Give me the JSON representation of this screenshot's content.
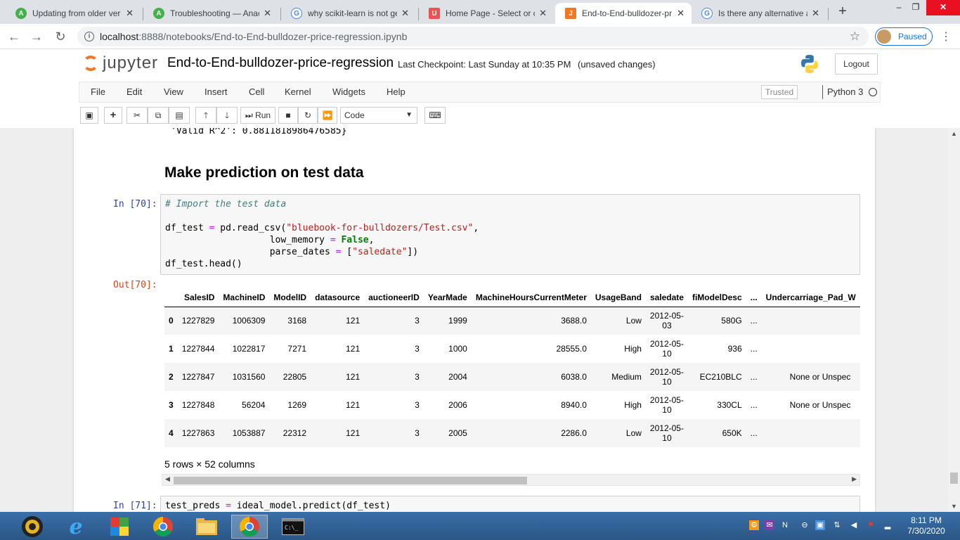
{
  "browser": {
    "tabs": [
      {
        "label": "Updating from older ver",
        "favicon": "anaconda-icon",
        "color": "#43b049"
      },
      {
        "label": "Troubleshooting — Anac",
        "favicon": "anaconda-icon",
        "color": "#43b049"
      },
      {
        "label": "why scikit-learn is not ge",
        "favicon": "google-icon",
        "color": "#4285f4"
      },
      {
        "label": "Home Page - Select or c",
        "favicon": "udemy-icon",
        "color": "#ec5252"
      },
      {
        "label": "End-to-End-bulldozer-pr",
        "favicon": "jupyter-icon",
        "color": "#f37726"
      },
      {
        "label": "Is there any alternative a",
        "favicon": "google-icon",
        "color": "#4285f4"
      }
    ],
    "url": "localhost:8888/notebooks/End-to-End-bulldozer-price-regression.ipynb",
    "url_host": "localhost",
    "url_rest": ":8888/notebooks/End-to-End-bulldozer-price-regression.ipynb",
    "profile_label": "Paused"
  },
  "jupyter": {
    "logo_text": "jupyter",
    "notebook_title": "End-to-End-bulldozer-price-regression",
    "checkpoint": "Last Checkpoint: Last Sunday at 10:35 PM",
    "unsaved": "(unsaved changes)",
    "logout_label": "Logout",
    "menu": [
      "File",
      "Edit",
      "View",
      "Insert",
      "Cell",
      "Kernel",
      "Widgets",
      "Help"
    ],
    "trusted_label": "Trusted",
    "kernel_name": "Python 3",
    "run_label": "Run",
    "cell_type": "Code"
  },
  "notebook": {
    "prev_output": "'Valid R^2': 0.8811818986476585}",
    "heading": "Make prediction on test data",
    "cell70": {
      "in_prompt": "In [70]:",
      "out_prompt": "Out[70]:",
      "comment": "# Import the test data",
      "line2_a": "df_test ",
      "line2_eq": "=",
      "line2_b": " pd.read_csv(",
      "line2_str": "\"bluebook-for-bulldozers/Test.csv\"",
      "line2_c": ",",
      "line3_a": "                   low_memory ",
      "line3_eq": "=",
      "line3_kw": " False",
      "line3_c": ",",
      "line4_a": "                   parse_dates ",
      "line4_eq": "=",
      "line4_b": " [",
      "line4_str": "\"saledate\"",
      "line4_c": "])",
      "line5": "df_test.head()"
    },
    "table": {
      "columns": [
        "",
        "SalesID",
        "MachineID",
        "ModelID",
        "datasource",
        "auctioneerID",
        "YearMade",
        "MachineHoursCurrentMeter",
        "UsageBand",
        "saledate",
        "fiModelDesc",
        "...",
        "Undercarriage_Pad_W"
      ],
      "rows": [
        [
          "0",
          "1227829",
          "1006309",
          "3168",
          "121",
          "3",
          "1999",
          "3688.0",
          "Low",
          "2012-05-03",
          "580G",
          "...",
          ""
        ],
        [
          "1",
          "1227844",
          "1022817",
          "7271",
          "121",
          "3",
          "1000",
          "28555.0",
          "High",
          "2012-05-10",
          "936",
          "...",
          ""
        ],
        [
          "2",
          "1227847",
          "1031560",
          "22805",
          "121",
          "3",
          "2004",
          "6038.0",
          "Medium",
          "2012-05-10",
          "EC210BLC",
          "...",
          "None or Unspec"
        ],
        [
          "3",
          "1227848",
          "56204",
          "1269",
          "121",
          "3",
          "2006",
          "8940.0",
          "High",
          "2012-05-10",
          "330CL",
          "...",
          "None or Unspec"
        ],
        [
          "4",
          "1227863",
          "1053887",
          "22312",
          "121",
          "3",
          "2005",
          "2286.0",
          "Low",
          "2012-05-10",
          "650K",
          "...",
          ""
        ]
      ],
      "date_parts": [
        [
          "2012-05-",
          "03"
        ],
        [
          "2012-05-",
          "10"
        ],
        [
          "2012-05-",
          "10"
        ],
        [
          "2012-05-",
          "10"
        ],
        [
          "2012-05-",
          "10"
        ]
      ]
    },
    "rows_info": "5 rows × 52 columns",
    "cell71": {
      "in_prompt": "In [71]:",
      "code_a": "test_preds ",
      "code_eq": "=",
      "code_b": " ideal_model.predict(df_test)"
    }
  },
  "taskbar": {
    "clock_time": "8:11 PM",
    "clock_date": "7/30/2020"
  }
}
